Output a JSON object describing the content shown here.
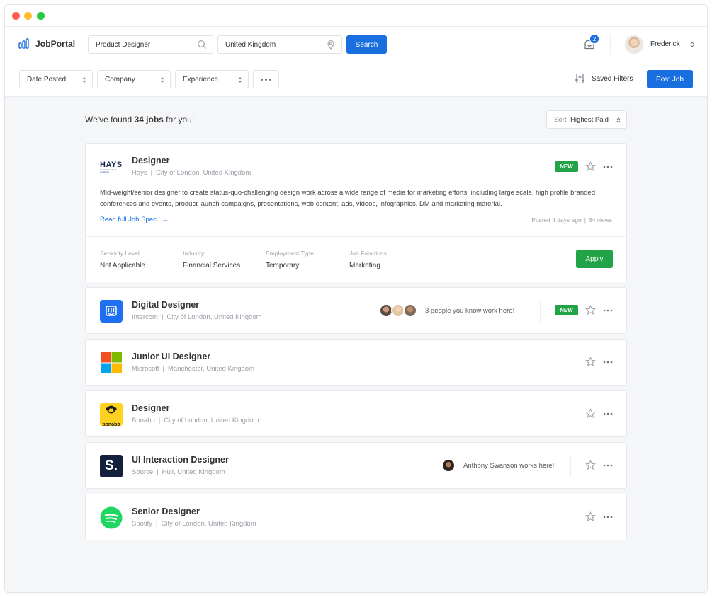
{
  "app": {
    "name": "JobPortal"
  },
  "search": {
    "keyword_value": "Product Designer",
    "location_value": "United Kingdom",
    "button_label": "Search"
  },
  "notifications": {
    "count": "2"
  },
  "user": {
    "name": "Frederick"
  },
  "filters": {
    "date_posted": "Date Posted",
    "company": "Company",
    "experience": "Experience",
    "saved_filters": "Saved Filters",
    "post_job": "Post Job"
  },
  "results": {
    "prefix": "We've found",
    "count_text": "34 jobs",
    "suffix": "for you!",
    "sort_label": "Sort:",
    "sort_value": "Highest Paid"
  },
  "jobs": [
    {
      "title": "Designer",
      "company": "Hays",
      "location": "City of London, United Kingdom",
      "badge": "NEW",
      "logo_text": "HAYS",
      "logo_tagline": "Recruiting experts worldwide",
      "description": "Mid-weight/senior designer to create status-quo-challenging design work across a wide range of media for marketing efforts, including large scale, high profile branded conferences and events, product launch campaigns, presentations, web content, ads, videos, infographics, DM and marketing material.",
      "read_more": "Read full Job Spec",
      "posted": "Posted 4 days ago",
      "views": "64 views",
      "details": [
        {
          "label": "Seniority Level",
          "value": "Not Applicable"
        },
        {
          "label": "Industry",
          "value": "Financial Services"
        },
        {
          "label": "Employment Type",
          "value": "Temporary"
        },
        {
          "label": "Job Functions",
          "value": "Marketing"
        }
      ],
      "apply_label": "Apply"
    },
    {
      "title": "Digital Designer",
      "company": "Intercom",
      "location": "City of London, United Kingdom",
      "badge": "NEW",
      "connections": "3 people you know work here!"
    },
    {
      "title": "Junior UI Designer",
      "company": "Microsoft",
      "location": "Manchester, United Kingdom"
    },
    {
      "title": "Designer",
      "company": "Bonabo",
      "location": "City of London, United Kingdom",
      "logo_text": "bonabo"
    },
    {
      "title": "UI Interaction Designer",
      "company": "Source",
      "location": "Hull, United Kingdom",
      "logo_text": "S.",
      "connections": "Anthony Swanson works here!"
    },
    {
      "title": "Senior Designer",
      "company": "Spotify",
      "location": "City of London, United Kingdom"
    }
  ],
  "colors": {
    "primary": "#1a6fe0",
    "success": "#22a347",
    "background": "#f5f6f8"
  },
  "icons": [
    "search-icon",
    "location-pin-icon",
    "inbox-icon",
    "sliders-icon",
    "star-icon",
    "more-icon",
    "arrow-right-icon",
    "chevron-updown-icon"
  ]
}
